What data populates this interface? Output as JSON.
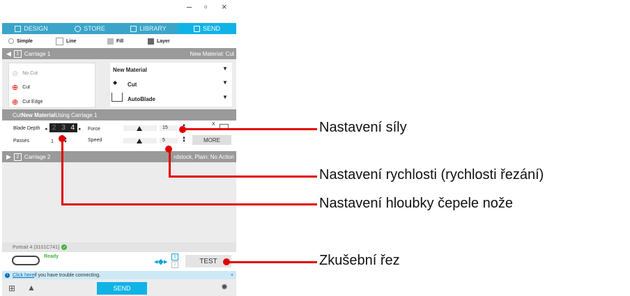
{
  "window_controls": {
    "minimize": "–",
    "maximize": "▫",
    "close": "×"
  },
  "tabs": [
    {
      "label": "DESIGN",
      "icon": "grid-icon"
    },
    {
      "label": "STORE",
      "icon": "store-icon"
    },
    {
      "label": "LIBRARY",
      "icon": "library-icon"
    },
    {
      "label": "SEND",
      "icon": "send-icon",
      "active": true
    }
  ],
  "modes": [
    "Simple",
    "Line",
    "Fill",
    "Layer"
  ],
  "carriage1": {
    "number": "1",
    "label": "Carriage 1",
    "material_right": "New Material: Cut"
  },
  "actions": [
    "No Cut",
    "Cut",
    "Cut Edge"
  ],
  "dropdowns": [
    "New Material",
    "Cut",
    "AutoBlade"
  ],
  "cut_info": {
    "prefix": "Cut ",
    "material": "New Material",
    "suffix": " Using Carriage 1"
  },
  "blade_depth": {
    "label": "Blade Depth",
    "values": [
      "2",
      "3",
      "4"
    ],
    "selected": "4"
  },
  "force": {
    "label": "Force",
    "value": "15"
  },
  "passes": {
    "label": "Passes",
    "value": "1"
  },
  "speed": {
    "label": "Speed",
    "value": "5"
  },
  "x_label": "X",
  "more_button": "MORE",
  "carriage2": {
    "number": "2",
    "label": "Carriage 2",
    "material_right": "rdstock, Plain: No Action"
  },
  "device": {
    "name": "Portrait 4  (3101C741)",
    "status": "Ready"
  },
  "test_button": "TEST",
  "carriage_nums": [
    "1",
    "2"
  ],
  "info_bar": {
    "link": "Click here",
    "text": " if you have trouble connecting.",
    "close": "×"
  },
  "send_button": "SEND",
  "annotations": [
    "Nastavení síly",
    "Nastavení rychlosti (rychlosti řezání)",
    "Nastavení hloubky čepele nože",
    "Zkušební řez"
  ],
  "colors": {
    "tab_bg": "#3aa5c9",
    "tab_active": "#11b3e6",
    "annotation": "#e10000",
    "ready": "#3fb53f"
  }
}
